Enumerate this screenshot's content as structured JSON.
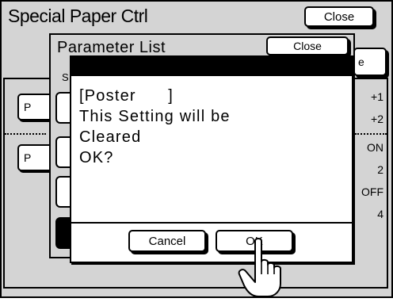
{
  "screen": {
    "title": "Special Paper Ctrl",
    "close_label": "Close"
  },
  "background_panel": {
    "button1_label": "P",
    "button2_label": "P",
    "right_button_label": "e",
    "right_values": [
      "+1",
      "+2",
      "ON",
      "2",
      "OFF",
      "4"
    ]
  },
  "parameter_list": {
    "title": "Parameter List",
    "close_label": "Close",
    "subtitle_fragment": "S"
  },
  "dialog": {
    "message": "[Poster      ]\nThis Setting will be\nCleared\nOK?",
    "cancel_label": "Cancel",
    "ok_label": "OK"
  },
  "cursor": {
    "icon": "hand-pointer-icon"
  }
}
